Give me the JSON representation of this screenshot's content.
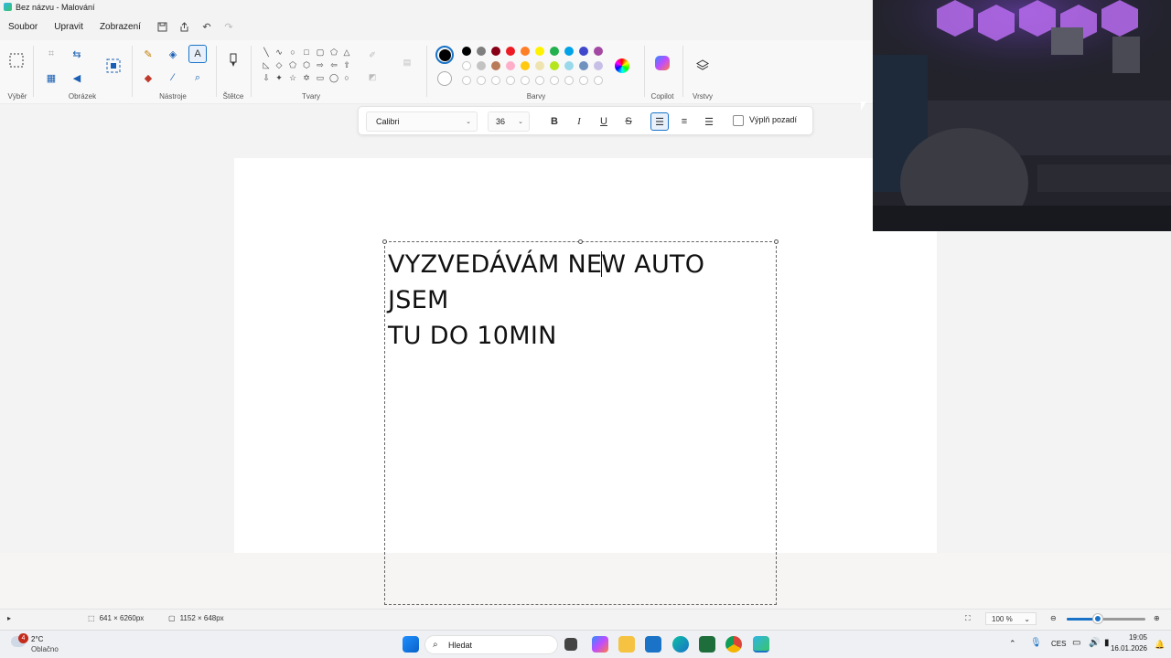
{
  "window": {
    "title": "Bez názvu - Malování"
  },
  "menu": {
    "file": "Soubor",
    "edit": "Upravit",
    "view": "Zobrazení"
  },
  "ribbon": {
    "groups": {
      "selection": "Výběr",
      "image": "Obrázek",
      "tools": "Nástroje",
      "brushes": "Štětce",
      "shapes": "Tvary",
      "colors": "Barvy",
      "copilot": "Copilot",
      "layers": "Vrstvy"
    },
    "palette_row1": [
      "#000000",
      "#7f7f7f",
      "#880015",
      "#ed1c24",
      "#ff7f27",
      "#fff200",
      "#22b14c",
      "#00a2e8",
      "#3f48cc",
      "#a349a4"
    ],
    "palette_row2": [
      "#ffffff",
      "#c3c3c3",
      "#b97a57",
      "#ffaec9",
      "#ffc90e",
      "#efe4b0",
      "#b5e61d",
      "#99d9ea",
      "#7092be",
      "#c8bfe7"
    ],
    "primary_color": "#000000",
    "secondary_color": "#ffffff"
  },
  "format": {
    "font": "Calibri",
    "size": "36",
    "fill_background": "Výplň pozadí"
  },
  "canvas": {
    "text_line1_a": "VYZVEDÁVÁM NE",
    "text_line1_b": "W AUTO JSEM",
    "text_line2": "TU DO 10MIN"
  },
  "statusbar": {
    "cursor_pos": "641 × 6260px",
    "canvas_size": "1152 × 648px",
    "zoom": "100 %",
    "zoom_level": 0.4
  },
  "taskbar": {
    "weather_temp": "2°C",
    "weather_desc": "Oblačno",
    "weather_badge": "4",
    "search_placeholder": "Hledat",
    "language": "CES",
    "time": "19:05",
    "date": "16.01.2026"
  }
}
